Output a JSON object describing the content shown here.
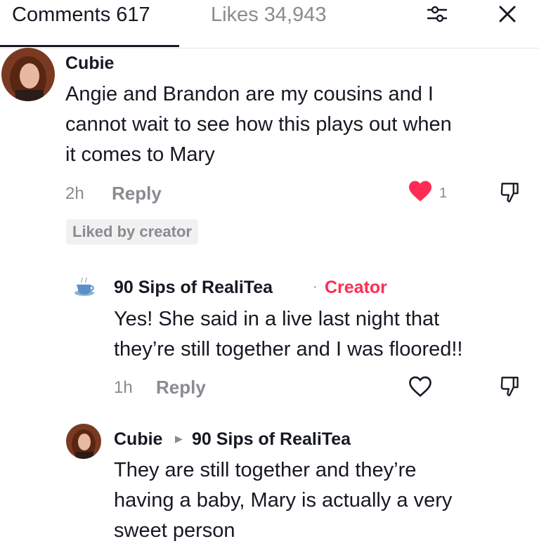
{
  "header": {
    "comments_tab": "Comments 617",
    "likes_tab": "Likes 34,943",
    "filter_icon": "sliders-icon",
    "close_icon": "close-icon"
  },
  "comments": [
    {
      "username": "Cubie",
      "text_lines": [
        "Angie and Brandon are my cousins and I",
        "cannot wait to see how this plays out when",
        "it comes to Mary"
      ],
      "time": "2h",
      "reply_label": "Reply",
      "likes": "1",
      "liked": true,
      "liked_by_creator": "Liked by creator"
    },
    {
      "username": "90 Sips of RealiTea",
      "creator_label": "Creator",
      "separator": "·",
      "text_lines": [
        "Yes! She said in a live last night that",
        "they’re still together and I was floored!!"
      ],
      "time": "1h",
      "reply_label": "Reply",
      "liked": false
    },
    {
      "username": "Cubie",
      "reply_to": "90 Sips of RealiTea",
      "text_lines": [
        "They are still together and they’re",
        "having a baby, Mary is actually a very",
        "sweet person"
      ]
    }
  ],
  "colors": {
    "accent": "#fe2c55",
    "text": "#161823",
    "muted": "#8a8b91"
  }
}
